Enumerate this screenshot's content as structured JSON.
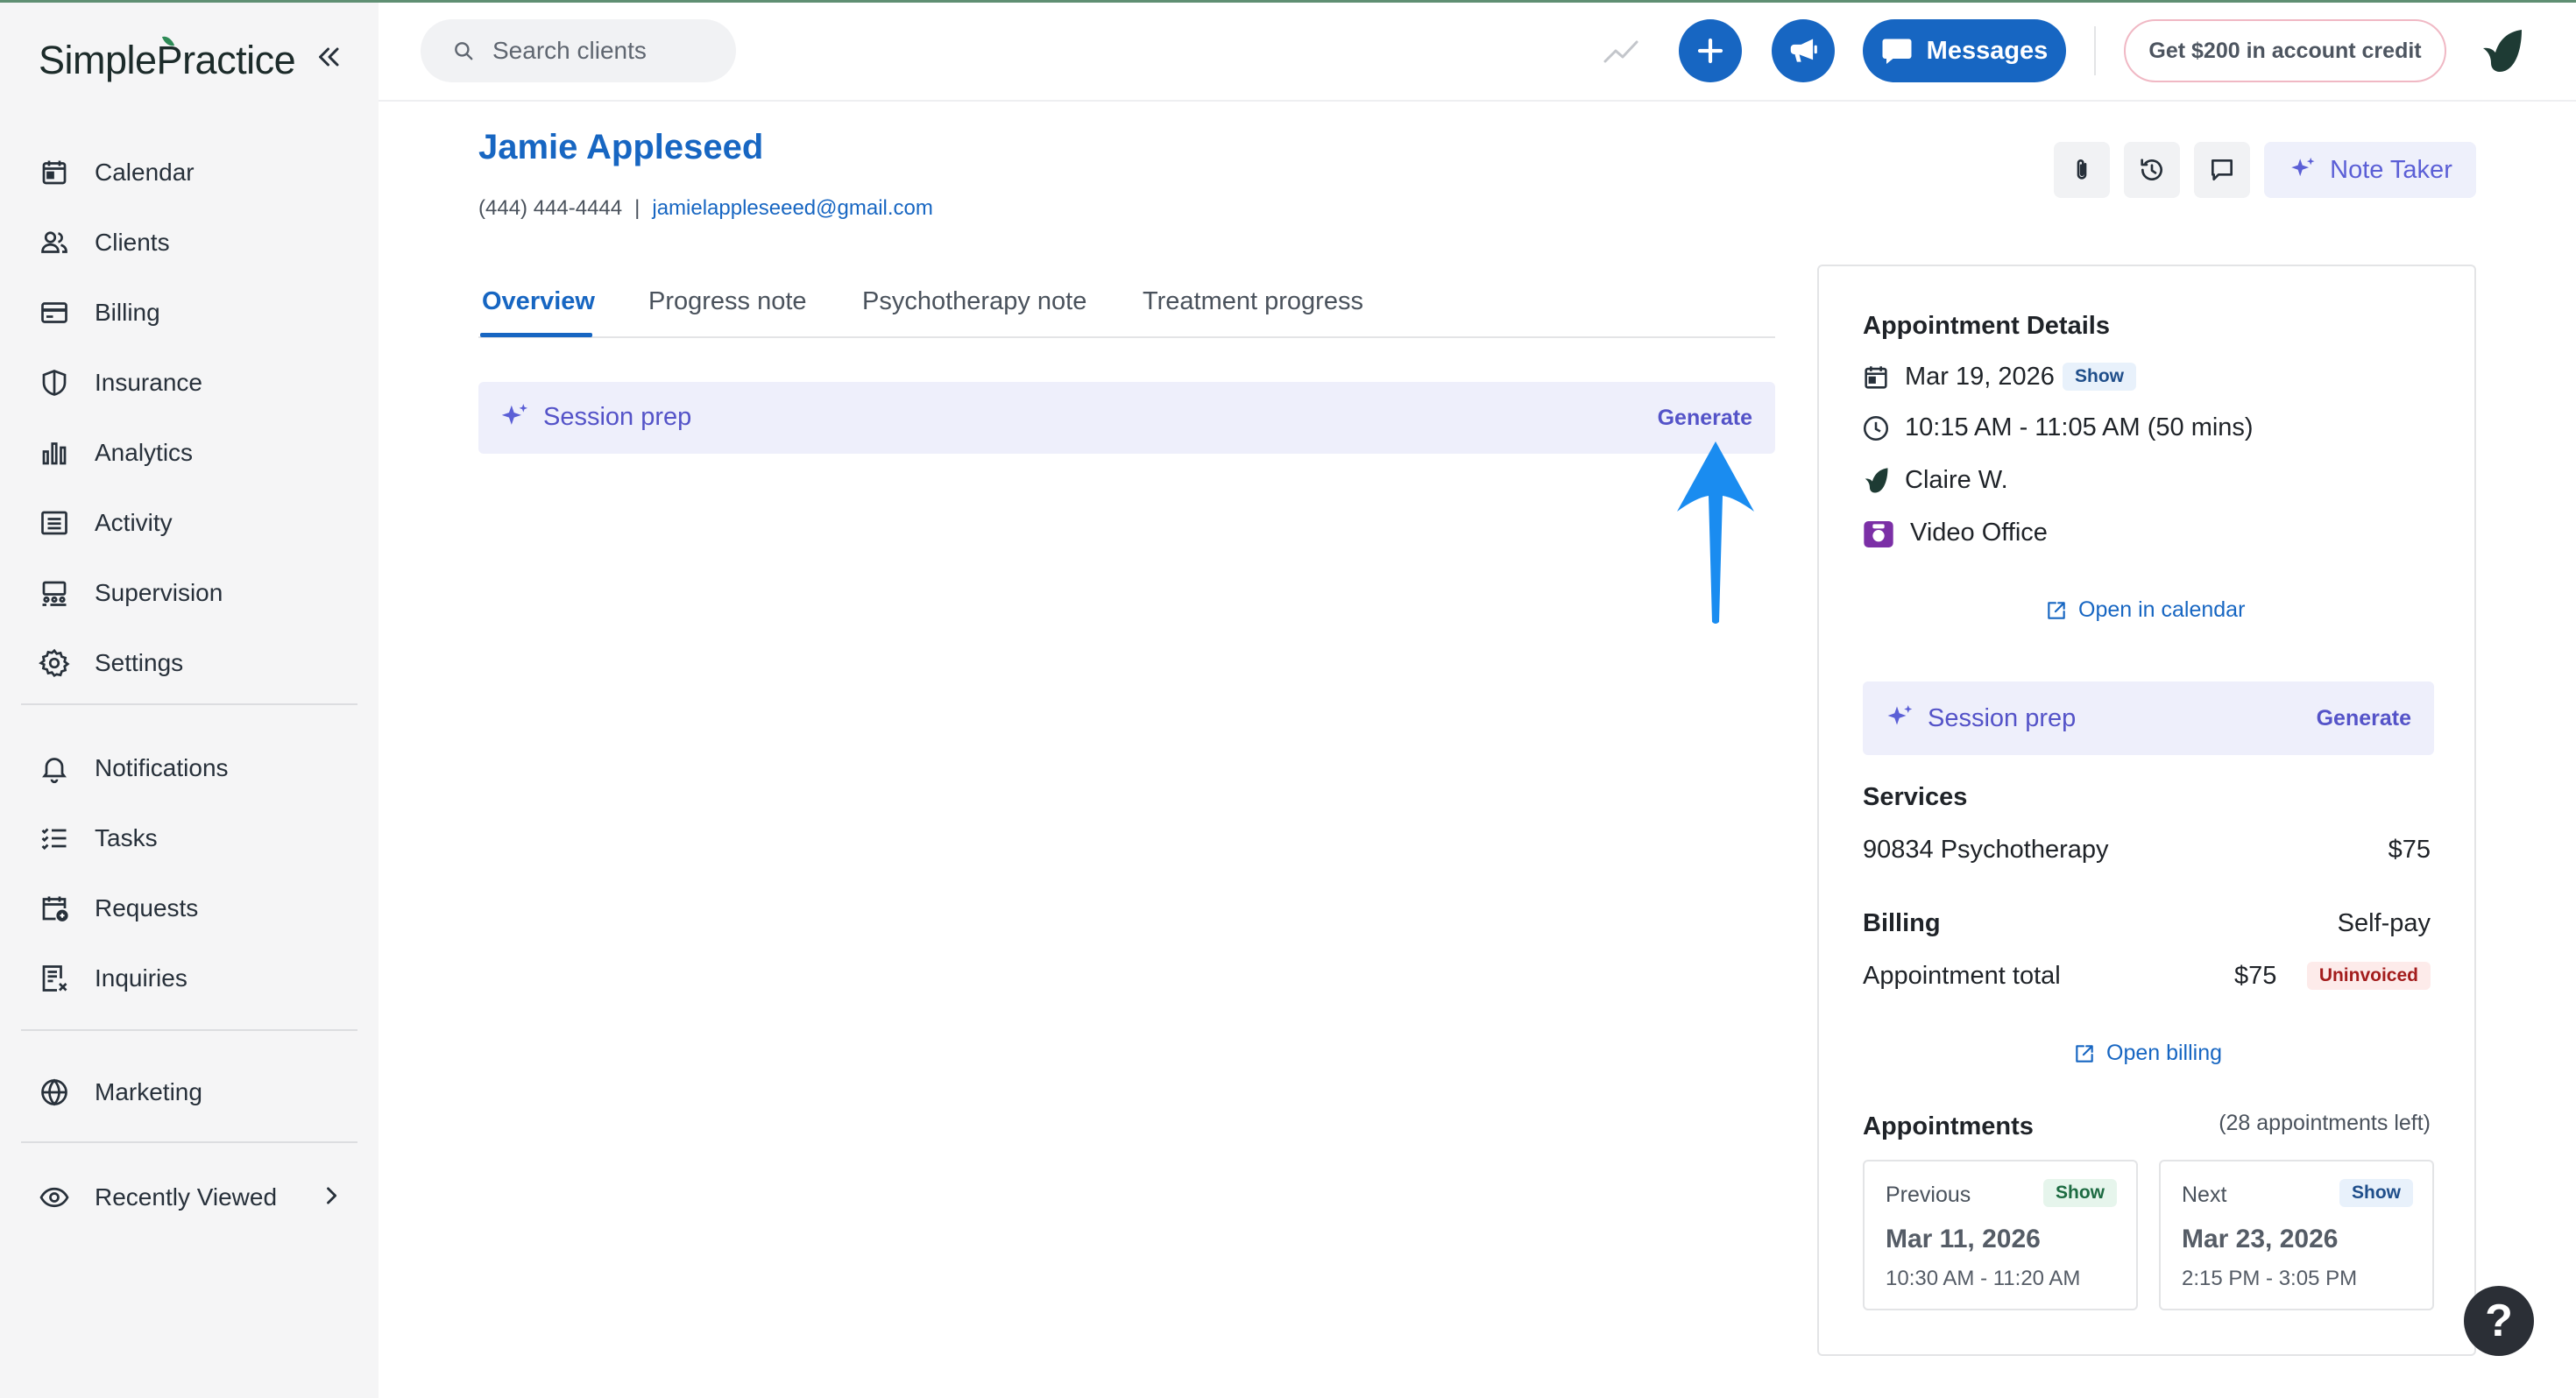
{
  "brand": {
    "name": "SimplePractice",
    "accent": "#1766c2",
    "sidebar_bg": "#f5f5f6"
  },
  "sidebar": {
    "items": [
      {
        "label": "Calendar",
        "icon": "calendar-icon"
      },
      {
        "label": "Clients",
        "icon": "users-icon"
      },
      {
        "label": "Billing",
        "icon": "credit-card-icon"
      },
      {
        "label": "Insurance",
        "icon": "shield-icon"
      },
      {
        "label": "Analytics",
        "icon": "bar-chart-icon"
      },
      {
        "label": "Activity",
        "icon": "list-icon"
      },
      {
        "label": "Supervision",
        "icon": "supervision-icon"
      },
      {
        "label": "Settings",
        "icon": "gear-icon"
      },
      {
        "label": "Notifications",
        "icon": "bell-icon"
      },
      {
        "label": "Tasks",
        "icon": "checklist-icon"
      },
      {
        "label": "Requests",
        "icon": "calendar-plus-icon"
      },
      {
        "label": "Inquiries",
        "icon": "inquiry-icon"
      },
      {
        "label": "Marketing",
        "icon": "globe-icon"
      },
      {
        "label": "Recently Viewed",
        "icon": "eye-icon"
      }
    ]
  },
  "topbar": {
    "search_placeholder": "Search clients",
    "messages_label": "Messages",
    "credit_label": "Get $200 in account credit"
  },
  "client": {
    "name": "Jamie Appleseed",
    "phone": "(444) 444-4444",
    "separator": "|",
    "email": "jamielappleseeed@gmail.com"
  },
  "toolbar": {
    "note_taker_label": "Note Taker"
  },
  "tabs": [
    {
      "label": "Overview",
      "active": true
    },
    {
      "label": "Progress note",
      "active": false
    },
    {
      "label": "Psychotherapy note",
      "active": false
    },
    {
      "label": "Treatment progress",
      "active": false
    }
  ],
  "session_prep": {
    "title": "Session prep",
    "action": "Generate"
  },
  "appointment": {
    "heading": "Appointment Details",
    "date": "Mar 19, 2026",
    "status": "Show",
    "time": "10:15 AM - 11:05 AM (50 mins)",
    "clinician": "Claire W.",
    "location": "Video Office",
    "open_calendar": "Open in calendar",
    "session_prep_title": "Session prep",
    "session_prep_action": "Generate",
    "services_heading": "Services",
    "service_name": "90834 Psychotherapy",
    "service_price": "$75",
    "billing_heading": "Billing",
    "billing_type": "Self-pay",
    "total_label": "Appointment total",
    "total_value": "$75",
    "invoice_status": "Uninvoiced",
    "open_billing": "Open billing",
    "appointments_heading": "Appointments",
    "appointments_left": "(28 appointments left)",
    "previous": {
      "label": "Previous",
      "status": "Show",
      "date": "Mar 11, 2026",
      "time": "10:30 AM - 11:20 AM"
    },
    "next": {
      "label": "Next",
      "status": "Show",
      "date": "Mar 23, 2026",
      "time": "2:15 PM - 3:05 PM"
    }
  },
  "help_label": "?"
}
